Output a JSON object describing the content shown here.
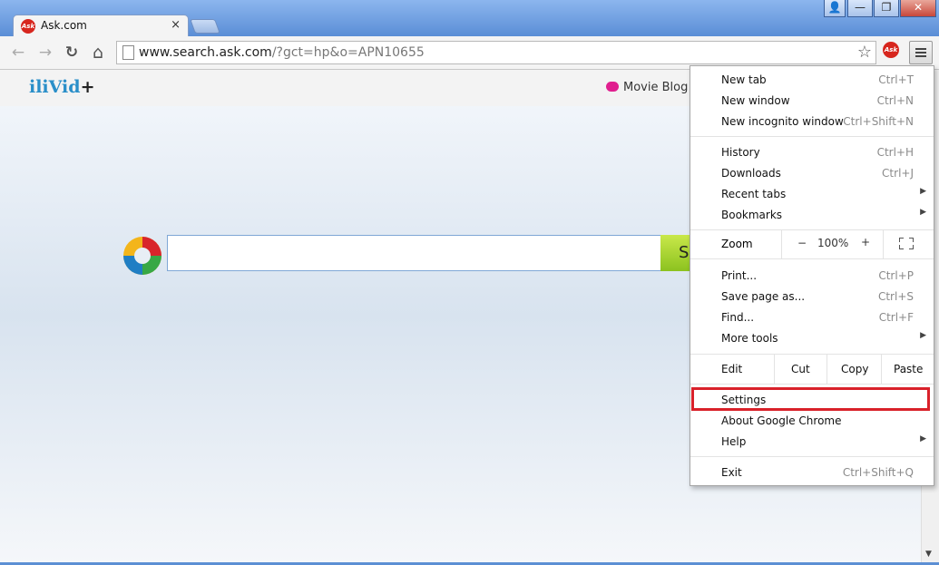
{
  "window": {
    "controls": [
      {
        "name": "profile-icon",
        "glyph": "👤"
      },
      {
        "name": "minimize-button",
        "glyph": "—"
      },
      {
        "name": "maximize-button",
        "glyph": "❐"
      },
      {
        "name": "close-window-button",
        "glyph": "✕"
      }
    ]
  },
  "tab": {
    "title": "Ask.com",
    "favicon_text": "Ask",
    "close": "×"
  },
  "toolbar": {
    "back": "←",
    "forward": "→",
    "reload": "↻",
    "home": "⌂",
    "url_host": "www.search.ask.com",
    "url_path": "/?gct=hp&o=APN10655",
    "star": "☆",
    "extension_text": "Ask"
  },
  "page": {
    "logo_main": "iliVid",
    "logo_plus": "+",
    "blog_link": "Movie Blog",
    "search_value": "",
    "search_button": "S"
  },
  "menu": {
    "group1": [
      {
        "label": "New tab",
        "shortcut": "Ctrl+T"
      },
      {
        "label": "New window",
        "shortcut": "Ctrl+N"
      },
      {
        "label": "New incognito window",
        "shortcut": "Ctrl+Shift+N"
      }
    ],
    "group2": [
      {
        "label": "History",
        "shortcut": "Ctrl+H",
        "submenu": ""
      },
      {
        "label": "Downloads",
        "shortcut": "Ctrl+J",
        "submenu": ""
      },
      {
        "label": "Recent tabs",
        "shortcut": "",
        "submenu": "▶"
      },
      {
        "label": "Bookmarks",
        "shortcut": "",
        "submenu": "▶"
      }
    ],
    "zoom": {
      "label": "Zoom",
      "minus": "−",
      "value": "100%",
      "plus": "+"
    },
    "group3": [
      {
        "label": "Print...",
        "shortcut": "Ctrl+P",
        "submenu": ""
      },
      {
        "label": "Save page as...",
        "shortcut": "Ctrl+S",
        "submenu": ""
      },
      {
        "label": "Find...",
        "shortcut": "Ctrl+F",
        "submenu": ""
      },
      {
        "label": "More tools",
        "shortcut": "",
        "submenu": "▶"
      }
    ],
    "edit": {
      "label": "Edit",
      "cut": "Cut",
      "copy": "Copy",
      "paste": "Paste"
    },
    "group4": [
      {
        "label": "Settings",
        "submenu": ""
      },
      {
        "label": "About Google Chrome",
        "submenu": ""
      },
      {
        "label": "Help",
        "submenu": "▶"
      }
    ],
    "exit": {
      "label": "Exit",
      "shortcut": "Ctrl+Shift+Q"
    }
  },
  "colors": {
    "highlight": "#d9212a",
    "search_button": "#9ccc2a",
    "titlebar": "#5a8ed6"
  }
}
